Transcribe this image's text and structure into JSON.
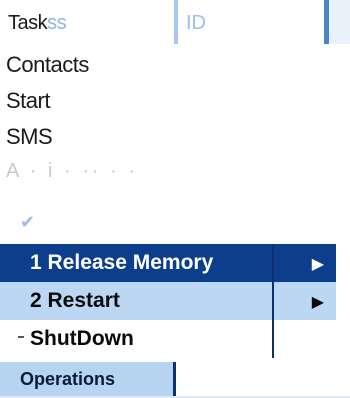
{
  "header": {
    "task_label": "Task",
    "task_suffix": "ss",
    "id_label": "ID"
  },
  "background_list": {
    "items": [
      "Contacts",
      "Start",
      "SMS",
      "A · i · ·· · ·"
    ]
  },
  "menu": {
    "items": [
      {
        "label": "1 Release Memory",
        "has_submenu": true,
        "selected": true
      },
      {
        "label": "2 Restart",
        "has_submenu": true,
        "selected": false
      },
      {
        "label": "ShutDown",
        "has_submenu": false,
        "selected": false
      }
    ]
  },
  "softkey": {
    "label": "Operations"
  },
  "icons": {
    "check": "checkmark-icon",
    "submenu_arrow": "triangle-right-icon"
  },
  "colors": {
    "selected_bg": "#0c3e8c",
    "hover_bg": "#bcd7f4",
    "accent": "#4a85c8"
  }
}
